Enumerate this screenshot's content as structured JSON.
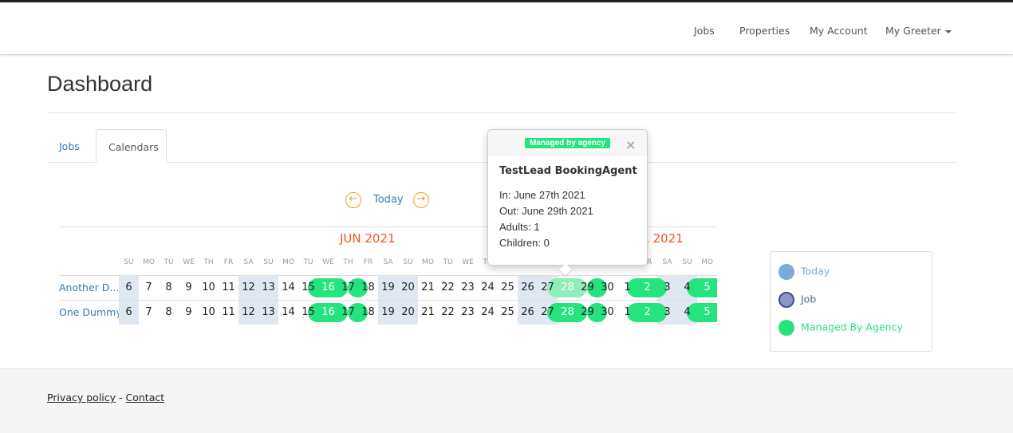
{
  "nav": {
    "items": [
      "Jobs",
      "Properties",
      "My Account",
      "My Greeter"
    ]
  },
  "page_title": "Dashboard",
  "tabs": [
    "Jobs",
    "Calendars"
  ],
  "calendar": {
    "today_label": "Today",
    "months": [
      "JUN 2021",
      "JUL 2021"
    ],
    "days": [
      {
        "d": "6",
        "w": "SU",
        "we": true
      },
      {
        "d": "7",
        "w": "MO"
      },
      {
        "d": "8",
        "w": "TU"
      },
      {
        "d": "9",
        "w": "WE"
      },
      {
        "d": "10",
        "w": "TH"
      },
      {
        "d": "11",
        "w": "FR"
      },
      {
        "d": "12",
        "w": "SA",
        "we": true
      },
      {
        "d": "13",
        "w": "SU",
        "we": true
      },
      {
        "d": "14",
        "w": "MO"
      },
      {
        "d": "15",
        "w": "TU"
      },
      {
        "d": "16",
        "w": "WE"
      },
      {
        "d": "17",
        "w": "TH"
      },
      {
        "d": "18",
        "w": "FR"
      },
      {
        "d": "19",
        "w": "SA",
        "we": true
      },
      {
        "d": "20",
        "w": "SU",
        "we": true
      },
      {
        "d": "21",
        "w": "MO"
      },
      {
        "d": "22",
        "w": "TU"
      },
      {
        "d": "23",
        "w": "WE"
      },
      {
        "d": "24",
        "w": "TH"
      },
      {
        "d": "25",
        "w": "FR"
      },
      {
        "d": "26",
        "w": "SA",
        "we": true
      },
      {
        "d": "27",
        "w": "SU",
        "we": true
      },
      {
        "d": "28",
        "w": "MO"
      },
      {
        "d": "29",
        "w": "TU"
      },
      {
        "d": "30",
        "w": "WE"
      },
      {
        "d": "1",
        "w": "TH"
      },
      {
        "d": "2",
        "w": "FR"
      },
      {
        "d": "3",
        "w": "SA",
        "we": true
      },
      {
        "d": "4",
        "w": "SU",
        "we": true
      },
      {
        "d": "5",
        "w": "MO"
      }
    ],
    "rows": [
      {
        "name": "Another D...",
        "bookings": [
          {
            "from": 9,
            "to": 11,
            "type": "agency"
          },
          {
            "from": 11,
            "to": 12,
            "type": "agency"
          },
          {
            "from": 21,
            "to": 23,
            "type": "agency",
            "hover": true
          },
          {
            "from": 23,
            "to": 24,
            "type": "agency"
          },
          {
            "from": 25,
            "to": 27,
            "type": "agency"
          },
          {
            "from": 28,
            "to": 30,
            "type": "agency"
          }
        ]
      },
      {
        "name": "One Dummy...",
        "bookings": [
          {
            "from": 9,
            "to": 11,
            "type": "agency"
          },
          {
            "from": 11,
            "to": 12,
            "type": "agency"
          },
          {
            "from": 21,
            "to": 23,
            "type": "agency"
          },
          {
            "from": 23,
            "to": 24,
            "type": "agency"
          },
          {
            "from": 25,
            "to": 27,
            "type": "agency"
          },
          {
            "from": 28,
            "to": 30,
            "type": "agency"
          }
        ]
      }
    ]
  },
  "popover": {
    "badge": "Managed by agency",
    "close": "×",
    "title": "TestLead BookingAgent",
    "lines": [
      "In: June 27th 2021",
      "Out: June 29th 2021",
      "Adults: 1",
      "Children: 0"
    ]
  },
  "legend": [
    {
      "label": "Today",
      "color": "#7eaad8"
    },
    {
      "label": "Job",
      "color": "#8e97c4"
    },
    {
      "label": "Managed By Agency",
      "color": "#25e47d"
    }
  ],
  "footer": {
    "privacy": "Privacy policy",
    "sep": " - ",
    "contact": "Contact"
  }
}
